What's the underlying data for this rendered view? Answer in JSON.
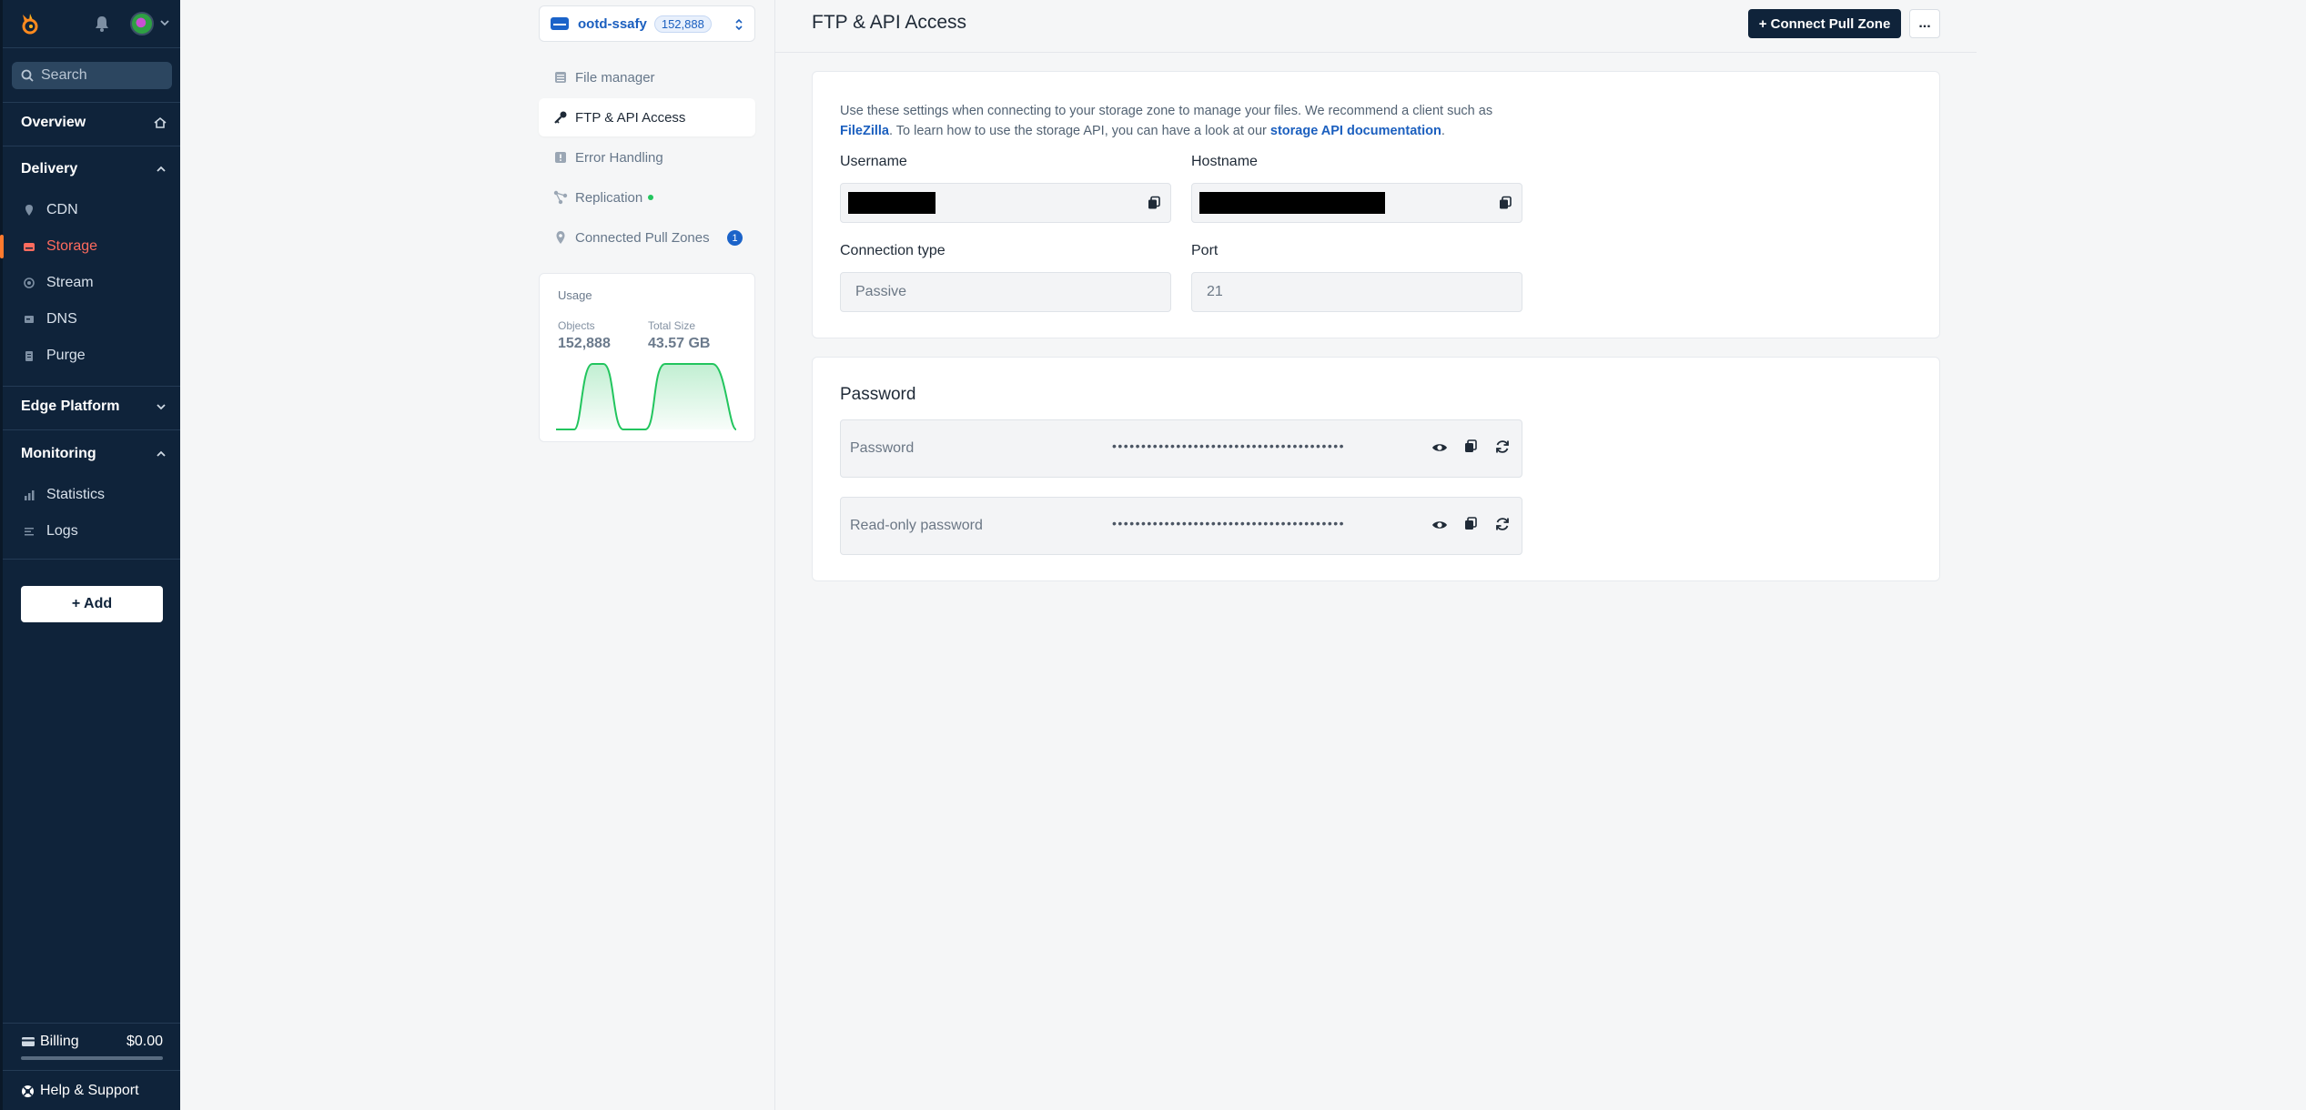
{
  "sidebar": {
    "search_placeholder": "Search",
    "overview": "Overview",
    "delivery": {
      "label": "Delivery",
      "items": [
        {
          "label": "CDN",
          "icon": "pin-icon"
        },
        {
          "label": "Storage",
          "icon": "storage-icon"
        },
        {
          "label": "Stream",
          "icon": "stream-icon"
        },
        {
          "label": "DNS",
          "icon": "dns-icon"
        },
        {
          "label": "Purge",
          "icon": "purge-icon"
        }
      ]
    },
    "edge_platform": "Edge Platform",
    "monitoring": {
      "label": "Monitoring",
      "items": [
        {
          "label": "Statistics",
          "icon": "statistics-icon"
        },
        {
          "label": "Logs",
          "icon": "logs-icon"
        }
      ]
    },
    "add_label": "+ Add",
    "billing_label": "Billing",
    "billing_amount": "$0.00",
    "help_label": "Help & Support"
  },
  "zone": {
    "name": "ootd-ssafy",
    "count": "152,888"
  },
  "subnav": {
    "items": [
      {
        "label": "File manager"
      },
      {
        "label": "FTP & API Access"
      },
      {
        "label": "Error Handling"
      },
      {
        "label": "Replication"
      },
      {
        "label": "Connected Pull Zones",
        "badge": "1"
      }
    ]
  },
  "usage": {
    "title": "Usage",
    "objects_label": "Objects",
    "objects_value": "152,888",
    "size_label": "Total Size",
    "size_value": "43.57 GB"
  },
  "header": {
    "title": "FTP & API Access",
    "connect_label": "+ Connect Pull Zone",
    "more_label": "..."
  },
  "ftp": {
    "desc_pre": "Use these settings when connecting to your storage zone to manage your files. We recommend a client such as ",
    "desc_link1": "FileZilla",
    "desc_mid": ". To learn how to use the storage API, you can have a look at our ",
    "desc_link2": "storage API documentation",
    "desc_end": ".",
    "username_label": "Username",
    "hostname_label": "Hostname",
    "connection_type_label": "Connection type",
    "connection_type_value": "Passive",
    "port_label": "Port",
    "port_value": "21"
  },
  "password": {
    "title": "Password",
    "rows": [
      {
        "label": "Password",
        "dots": "••••••••••••••••••••••••••••••••••••••••"
      },
      {
        "label": "Read-only password",
        "dots": "••••••••••••••••••••••••••••••••••••••••"
      }
    ]
  },
  "colors": {
    "sidebar_bg": "#0f233a",
    "accent_active": "#ff6b5e",
    "link_blue": "#1b5fbf",
    "chart_green": "#22c55e"
  }
}
